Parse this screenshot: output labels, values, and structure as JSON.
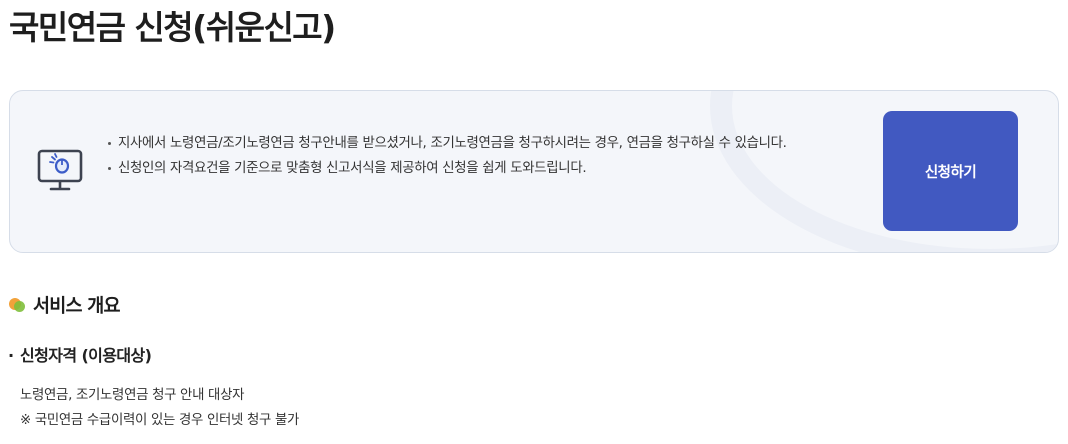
{
  "page": {
    "title": "국민연금 신청(쉬운신고)"
  },
  "notice": {
    "icon": "monitor-click-icon",
    "items": [
      "지사에서 노령연금/조기노령연금 청구안내를 받으셨거나, 조기노령연금을 청구하시려는 경우, 연금을 청구하실 수 있습니다.",
      "신청인의 자격요건을 기준으로 맞춤형 신고서식을 제공하여 신청을 쉽게 도와드립니다."
    ],
    "apply_button_label": "신청하기"
  },
  "colors": {
    "button": "#4159c1",
    "box_background": "#f4f6fa",
    "dot_orange": "#f2a23a",
    "dot_green": "#7fbf3b"
  },
  "overview": {
    "title": "서비스 개요",
    "eligibility": {
      "bullet": "·",
      "title": "신청자격 (이용대상)",
      "lines": [
        "노령연금, 조기노령연금 청구 안내 대상자",
        "※ 국민연금 수급이력이 있는 경우 인터넷 청구 불가"
      ]
    }
  }
}
